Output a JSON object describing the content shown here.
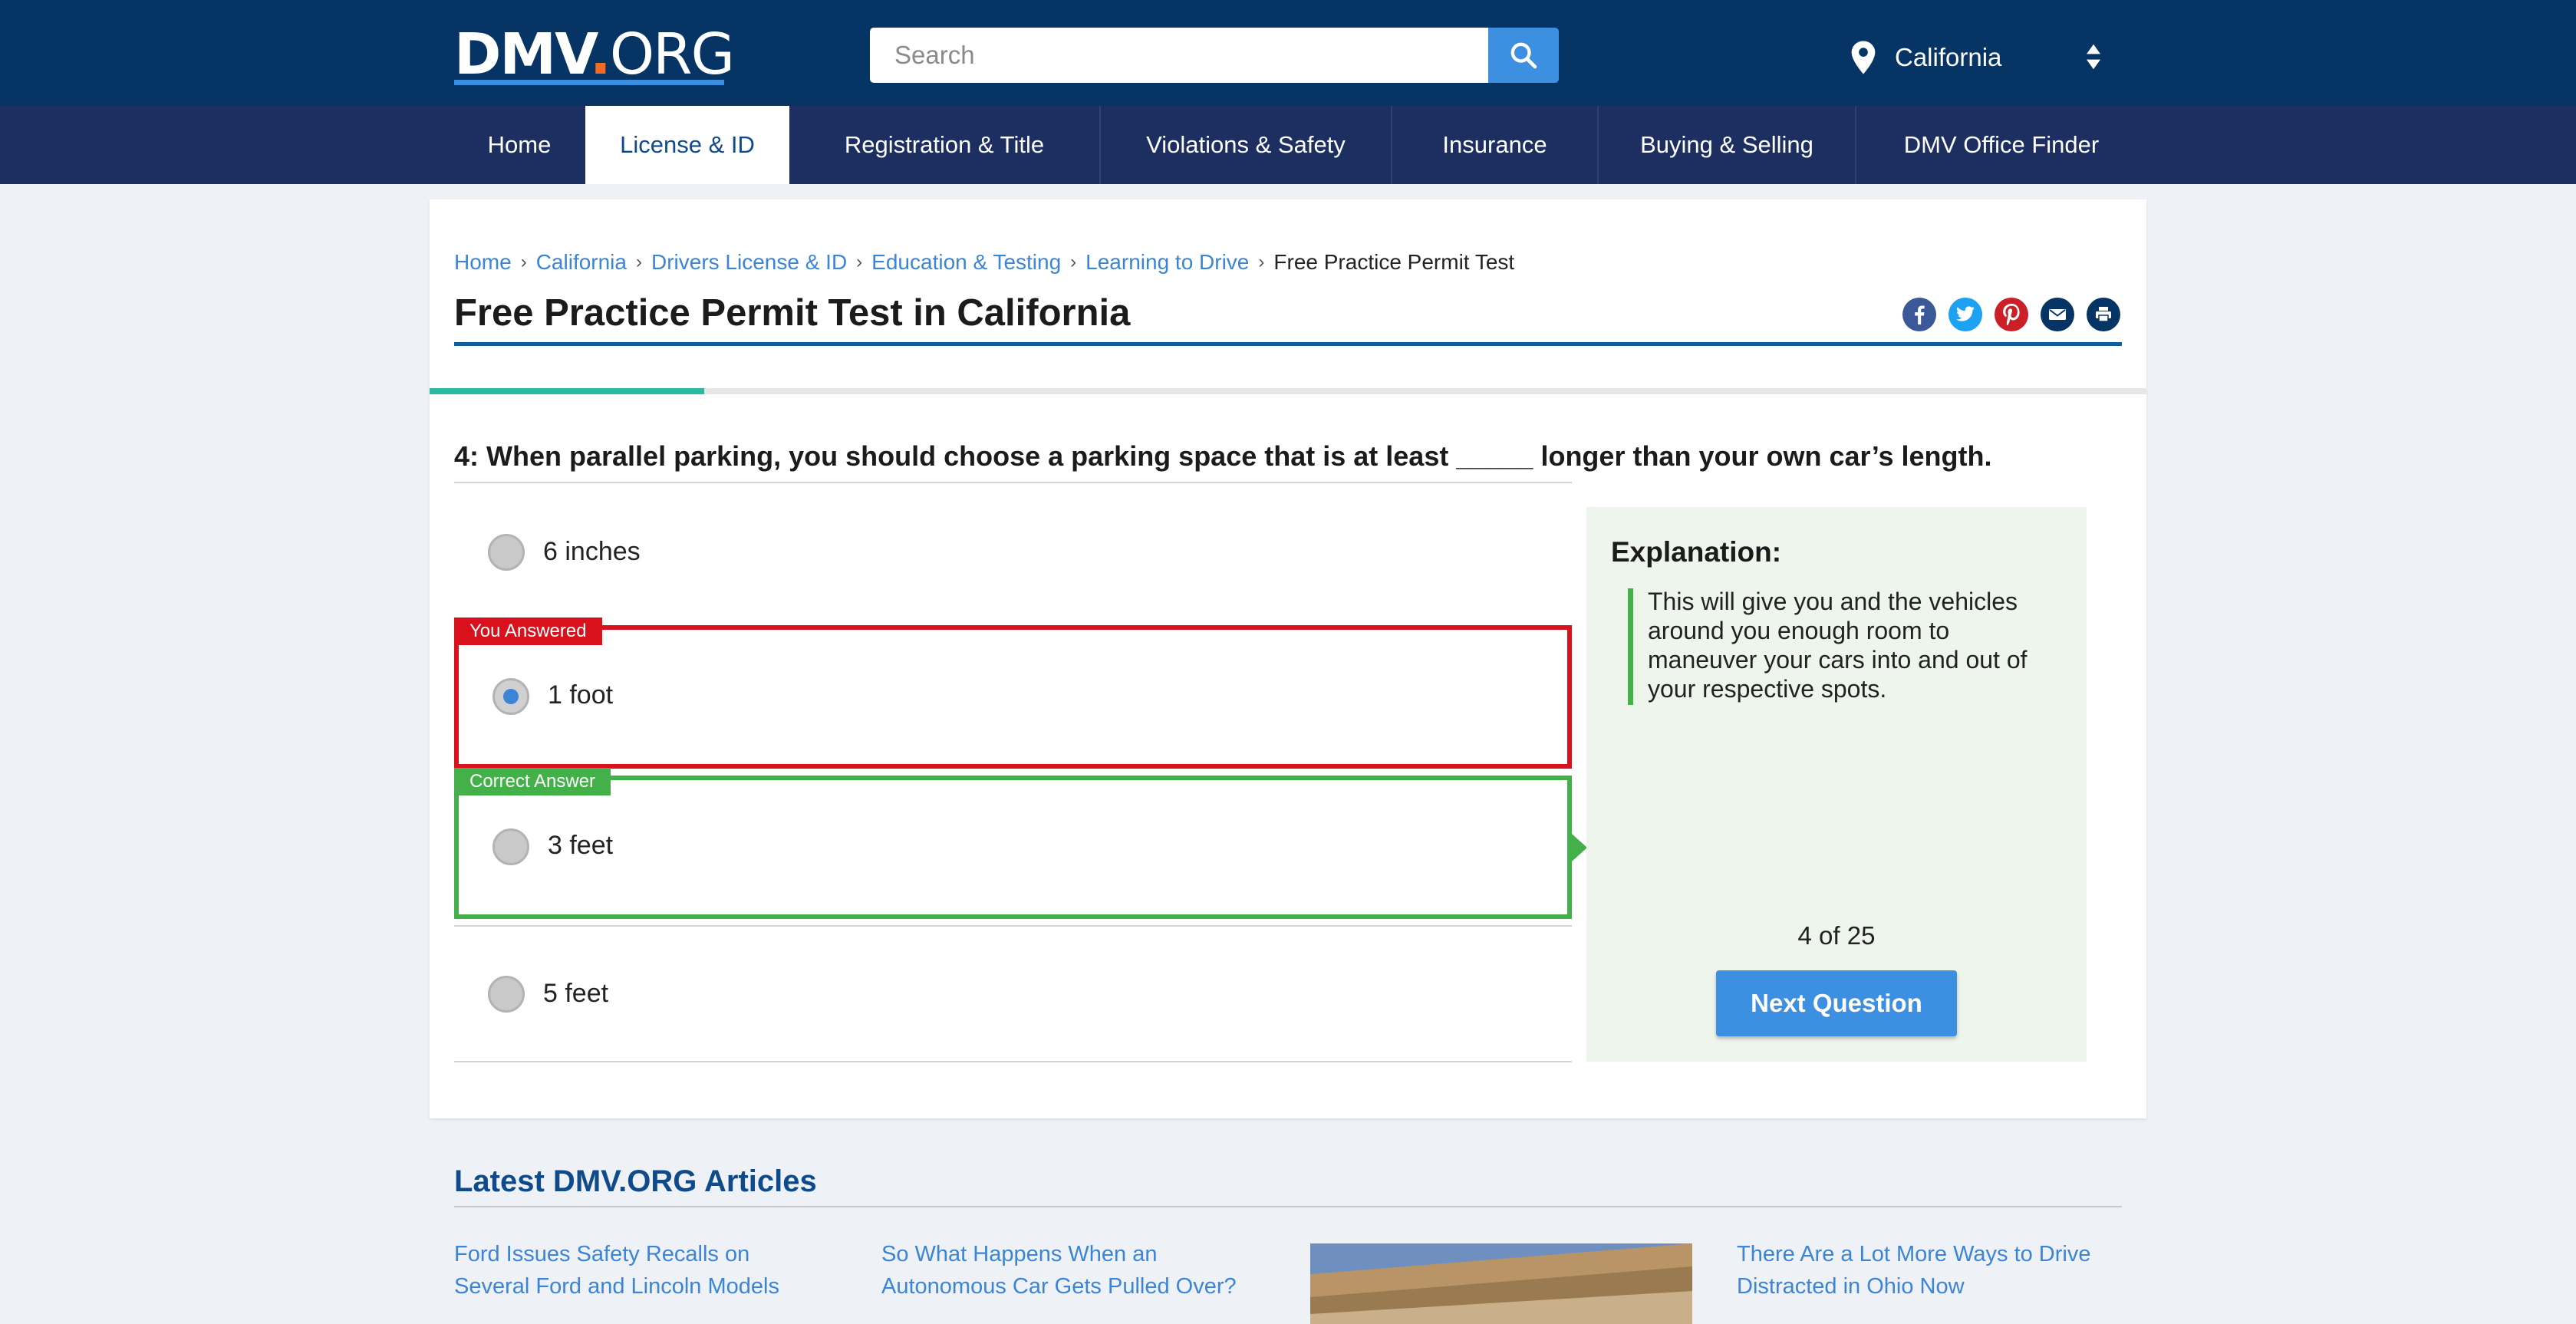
{
  "header": {
    "logo": {
      "dmv": "DMV",
      "dot": ".",
      "org": "ORG"
    },
    "search": {
      "placeholder": "Search",
      "value": ""
    },
    "state": {
      "label": "California"
    }
  },
  "nav": {
    "items": [
      {
        "label": "Home",
        "active": false
      },
      {
        "label": "License & ID",
        "active": true
      },
      {
        "label": "Registration & Title",
        "active": false
      },
      {
        "label": "Violations & Safety",
        "active": false
      },
      {
        "label": "Insurance",
        "active": false
      },
      {
        "label": "Buying & Selling",
        "active": false
      },
      {
        "label": "DMV Office Finder",
        "active": false
      }
    ]
  },
  "breadcrumb": {
    "items": [
      "Home",
      "California",
      "Drivers License & ID",
      "Education & Testing",
      "Learning to Drive"
    ],
    "current": "Free Practice Permit Test"
  },
  "page": {
    "title": "Free Practice Permit Test in California"
  },
  "share": [
    "facebook-icon",
    "twitter-icon",
    "pinterest-icon",
    "email-icon",
    "print-icon"
  ],
  "quiz": {
    "progress_fraction": 0.16,
    "question": "4: When parallel parking, you should choose a parking space that is at least _____ longer than your own car’s length.",
    "options": [
      {
        "label": "6 inches",
        "selected": false,
        "status": ""
      },
      {
        "label": "1 foot",
        "selected": true,
        "status": "You Answered"
      },
      {
        "label": "3 feet",
        "selected": false,
        "status": "Correct Answer"
      },
      {
        "label": "5 feet",
        "selected": false,
        "status": ""
      }
    ],
    "explanation": {
      "title": "Explanation:",
      "text": "This will give you and the vehicles around you enough room to maneuver your cars into and out of your respective spots."
    },
    "counter": "4 of 25",
    "next_label": "Next Question"
  },
  "articles": {
    "title": "Latest DMV.ORG Articles",
    "items": [
      "Ford Issues Safety Recalls on Several Ford and Lincoln Models",
      "So What Happens When an Autonomous Car Gets Pulled Over?",
      "There Are a Lot More Ways to Drive Distracted in Ohio Now"
    ]
  },
  "colors": {
    "header_bg": "#063464",
    "nav_bg": "#1c2f60",
    "accent_blue": "#3d8fe2",
    "wrong_red": "#d9111c",
    "correct_green": "#44b04a",
    "progress_teal": "#2ab8a2"
  }
}
